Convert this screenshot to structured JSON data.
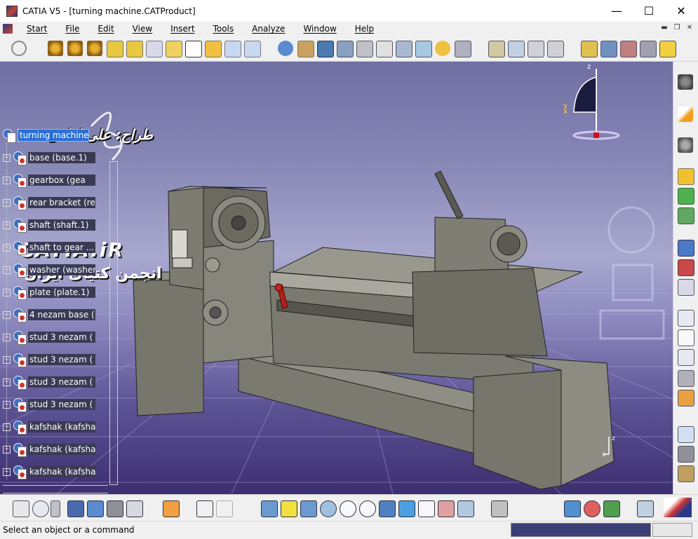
{
  "window": {
    "title": "CATIA V5 - [turning machine.CATProduct]",
    "minimize": "—",
    "maximize": "☐",
    "close": "✕"
  },
  "menu": [
    {
      "label": "Start"
    },
    {
      "label": "File"
    },
    {
      "label": "Edit"
    },
    {
      "label": "View"
    },
    {
      "label": "Insert"
    },
    {
      "label": "Tools"
    },
    {
      "label": "Analyze"
    },
    {
      "label": "Window"
    },
    {
      "label": "Help"
    }
  ],
  "watermark": {
    "designer": "طراح: علی لطفی",
    "site": "CATIA.iR",
    "society": "انجمن کتیای ایران"
  },
  "tree": {
    "root": "turning machine",
    "nodes": [
      {
        "label": "base (base.1)"
      },
      {
        "label": "gearbox (gea"
      },
      {
        "label": "rear bracket (re"
      },
      {
        "label": "shaft (shaft.1)"
      },
      {
        "label": "shaft to gear ..."
      },
      {
        "label": "washer (washer"
      },
      {
        "label": "plate (plate.1)"
      },
      {
        "label": "4 nezam base ("
      },
      {
        "label": "stud 3 nezam ("
      },
      {
        "label": "stud 3 nezam ("
      },
      {
        "label": "stud 3 nezam ("
      },
      {
        "label": "stud 3 nezam ("
      },
      {
        "label": "kafshak (kafsha"
      },
      {
        "label": "kafshak (kafsha"
      },
      {
        "label": "kafshak (kafsha"
      }
    ]
  },
  "compass": {
    "z": "z",
    "y": "y",
    "x": "x"
  },
  "axis_small": {
    "z": "z",
    "x": "x"
  },
  "status": {
    "message": "Select an object or a command"
  },
  "colors": {
    "titlebar": "#ffffff",
    "viewport_top": "#6f6fa3",
    "viewport_bottom": "#3c2f70",
    "selection": "#2b6fd6",
    "machine": "#6b6b60"
  }
}
